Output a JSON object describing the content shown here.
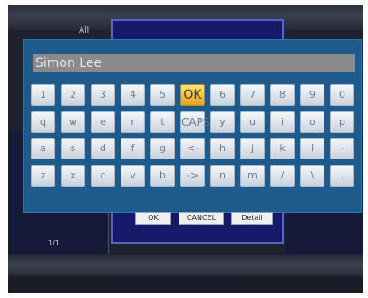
{
  "top_bar": {
    "text": "All"
  },
  "input": {
    "value": "Simon Lee"
  },
  "keyboard": {
    "rows": [
      [
        "1",
        "2",
        "3",
        "4",
        "5",
        "OK",
        "6",
        "7",
        "8",
        "9",
        "0"
      ],
      [
        "q",
        "w",
        "e",
        "r",
        "t",
        "CAPS",
        "y",
        "u",
        "i",
        "o",
        "p"
      ],
      [
        "a",
        "s",
        "d",
        "f",
        "g",
        "<-",
        "h",
        "j",
        "k",
        "l",
        "-"
      ],
      [
        "z",
        "x",
        "c",
        "v",
        "b",
        "->",
        "n",
        "m",
        "/",
        "\\",
        "."
      ]
    ],
    "selected_key": "OK"
  },
  "dialog_buttons": {
    "ok": "OK",
    "cancel": "CANCEL",
    "detail": "Detail"
  },
  "page_indicator": "1/1",
  "colors": {
    "keyboard_bg": "#1e5a8c",
    "dialog_bg": "#15196a",
    "selected_key": "#f2c646",
    "key": "#e4e9ef"
  }
}
